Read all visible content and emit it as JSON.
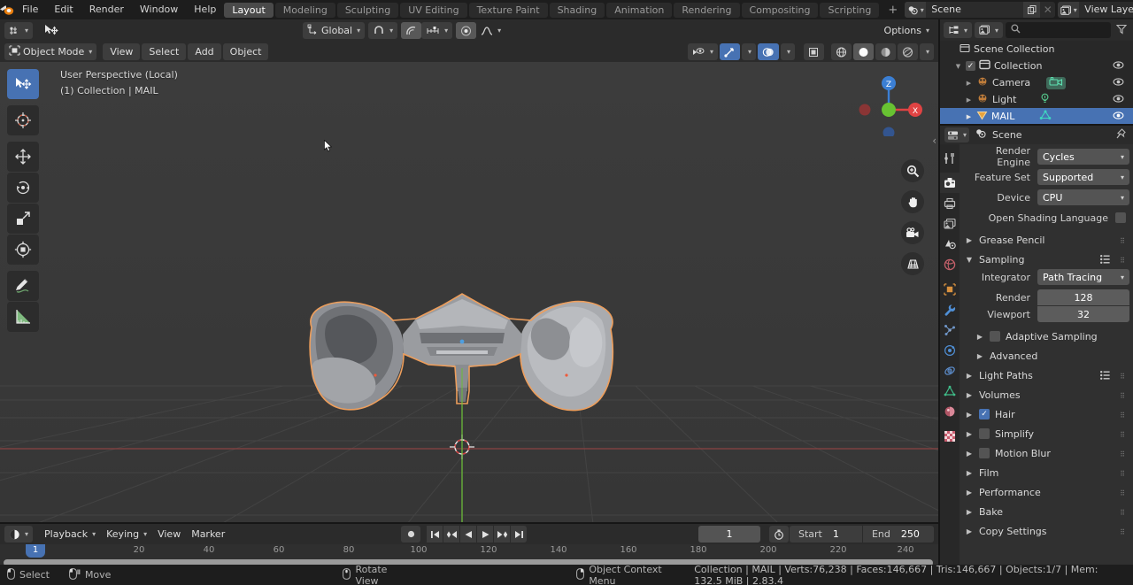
{
  "topbar": {
    "logo_icon": "blender-logo-icon",
    "menus": [
      "File",
      "Edit",
      "Render",
      "Window",
      "Help"
    ],
    "workspaces": [
      {
        "label": "Layout",
        "active": true
      },
      {
        "label": "Modeling",
        "active": false
      },
      {
        "label": "Sculpting",
        "active": false
      },
      {
        "label": "UV Editing",
        "active": false
      },
      {
        "label": "Texture Paint",
        "active": false
      },
      {
        "label": "Shading",
        "active": false
      },
      {
        "label": "Animation",
        "active": false
      },
      {
        "label": "Rendering",
        "active": false
      },
      {
        "label": "Compositing",
        "active": false
      },
      {
        "label": "Scripting",
        "active": false
      }
    ],
    "add_workspace_label": "+",
    "scene_icon": "scene-icon",
    "scene_name": "Scene",
    "viewlayer_icon": "view-layer-icon",
    "viewlayer_name": "View Layer",
    "new_icon": "duplicate-icon",
    "remove_icon": "close-icon"
  },
  "viewport_header": {
    "editor_type_icon": "editor-type-3dview-icon",
    "cursor_tool_icon": "tweak-move-icon",
    "mode_icon": "object-mode-icon",
    "mode_label": "Object Mode",
    "menus": [
      "View",
      "Select",
      "Add",
      "Object"
    ],
    "transform_orientation_icon": "orientation-icon",
    "transform_orientation": "Global",
    "snap_icon": "snap-magnet-icon",
    "proportional_icon": "proportional-edit-icon",
    "proportional_falloff_icon": "falloff-smooth-icon",
    "options_label": "Options",
    "visibility_icon": "show-hide-icon",
    "gizmo_icon": "gizmo-icon",
    "overlays_icon": "overlays-icon",
    "xray_icon": "xray-toggle-icon",
    "shading_modes": [
      "wireframe-shading-icon",
      "solid-shading-icon",
      "material-preview-icon",
      "rendered-shading-icon"
    ],
    "active_shading": "solid-shading-icon"
  },
  "viewport": {
    "overlay_line1": "User Perspective (Local)",
    "overlay_line2": "(1) Collection | MAIL",
    "toolbar_tools": [
      {
        "name": "tweak-tool",
        "icon": "cursor-move-icon",
        "active": true
      },
      {
        "name": "cursor-tool",
        "icon": "3d-cursor-icon",
        "active": false
      },
      {
        "name": "move-tool",
        "icon": "move-arrows-icon",
        "active": false
      },
      {
        "name": "rotate-tool",
        "icon": "rotate-icon",
        "active": false
      },
      {
        "name": "scale-tool",
        "icon": "scale-icon",
        "active": false
      },
      {
        "name": "transform-tool",
        "icon": "transform-icon",
        "active": false
      },
      {
        "name": "annotate-tool",
        "icon": "pencil-icon",
        "active": false
      },
      {
        "name": "measure-tool",
        "icon": "ruler-icon",
        "active": false
      }
    ],
    "gizmo_axes": [
      "Z",
      "X"
    ],
    "nav_buttons": [
      "zoom-icon",
      "pan-hand-icon",
      "camera-view-icon",
      "ortho-persp-icon"
    ],
    "object_name": "MAIL"
  },
  "timeline": {
    "editor_icon": "timeline-editor-icon",
    "menus": [
      "Playback",
      "Keying",
      "View",
      "Marker"
    ],
    "record_icon": "record-keyframe-icon",
    "transport": [
      "jump-start-icon",
      "prev-keyframe-icon",
      "play-reverse-icon",
      "play-icon",
      "next-keyframe-icon",
      "jump-end-icon"
    ],
    "current_frame": "1",
    "timer_icon": "use-preview-range-icon",
    "start_label": "Start",
    "start_value": "1",
    "end_label": "End",
    "end_value": "250",
    "ruler_ticks": [
      "20",
      "40",
      "60",
      "80",
      "100",
      "120",
      "140",
      "160",
      "180",
      "200",
      "220",
      "240"
    ],
    "playhead_label": "1"
  },
  "outliner": {
    "display_mode_icon": "outliner-display-mode-icon",
    "filter_collection_icon": "outliner-filter-id-icon",
    "search_placeholder": "",
    "search_icon": "search-icon",
    "filter_icon": "filter-funnel-icon",
    "rows": [
      {
        "label": "Scene Collection",
        "icon": "scene-collection-icon",
        "indent": 0,
        "selected": false,
        "has_eye": false,
        "has_checkbox": false,
        "has_disclosure": false
      },
      {
        "label": "Collection",
        "icon": "collection-icon",
        "indent": 1,
        "selected": false,
        "has_eye": true,
        "has_checkbox": true,
        "has_disclosure": true
      },
      {
        "label": "Camera",
        "icon": "camera-object-icon",
        "data_icon": "camera-data-icon",
        "indent": 2,
        "selected": false,
        "has_eye": true,
        "has_checkbox": false,
        "has_disclosure": true
      },
      {
        "label": "Light",
        "icon": "light-object-icon",
        "data_icon": "light-data-icon",
        "indent": 2,
        "selected": false,
        "has_eye": true,
        "has_checkbox": false,
        "has_disclosure": true
      },
      {
        "label": "MAIL",
        "icon": "mesh-object-icon",
        "data_icon": "mesh-data-icon",
        "indent": 2,
        "selected": true,
        "has_eye": true,
        "has_checkbox": false,
        "has_disclosure": true
      }
    ]
  },
  "properties": {
    "editor_icon": "properties-editor-icon",
    "breadcrumb_icon": "scene-icon",
    "breadcrumb": "Scene",
    "pin_icon": "pin-icon",
    "tabs": [
      {
        "name": "tool-tab",
        "icon": "tool-icon",
        "active": false
      },
      {
        "name": "render-tab",
        "icon": "render-camera-icon",
        "active": true
      },
      {
        "name": "output-tab",
        "icon": "printer-icon",
        "active": false
      },
      {
        "name": "viewlayer-tab",
        "icon": "images-icon",
        "active": false
      },
      {
        "name": "scene-tab",
        "icon": "scene-cone-icon",
        "active": false
      },
      {
        "name": "world-tab",
        "icon": "world-globe-icon",
        "active": false
      },
      {
        "name": "object-tab",
        "icon": "object-square-icon",
        "active": false
      },
      {
        "name": "modifier-tab",
        "icon": "wrench-icon",
        "active": false
      },
      {
        "name": "particles-tab",
        "icon": "particles-icon",
        "active": false
      },
      {
        "name": "physics-tab",
        "icon": "physics-orbit-icon",
        "active": false
      },
      {
        "name": "constraints-tab",
        "icon": "constraints-icon",
        "active": false
      },
      {
        "name": "data-tab",
        "icon": "mesh-data-triangle-icon",
        "active": false
      },
      {
        "name": "material-tab",
        "icon": "material-sphere-icon",
        "active": false
      },
      {
        "name": "texture-tab",
        "icon": "texture-checker-icon",
        "active": false
      }
    ],
    "fields": [
      {
        "label": "Render Engine",
        "value": "Cycles",
        "type": "dropdown"
      },
      {
        "label": "Feature Set",
        "value": "Supported",
        "type": "dropdown"
      },
      {
        "label": "Device",
        "value": "CPU",
        "type": "dropdown"
      }
    ],
    "osl_label": "Open Shading Language",
    "osl_checked": false,
    "panels": [
      {
        "label": "Grease Pencil",
        "open": false,
        "indent": 0,
        "checkbox": null,
        "list_icon": false
      },
      {
        "label": "Sampling",
        "open": true,
        "indent": 0,
        "checkbox": null,
        "list_icon": true
      }
    ],
    "sampling": {
      "integrator_label": "Integrator",
      "integrator_value": "Path Tracing",
      "render_label": "Render",
      "render_value": "128",
      "viewport_label": "Viewport",
      "viewport_value": "32",
      "adaptive_label": "Adaptive Sampling",
      "adaptive_checked": false,
      "advanced_label": "Advanced"
    },
    "panels2": [
      {
        "label": "Light Paths",
        "open": false,
        "checkbox": null,
        "list_icon": true
      },
      {
        "label": "Volumes",
        "open": false,
        "checkbox": null,
        "list_icon": false
      },
      {
        "label": "Hair",
        "open": false,
        "checkbox": true,
        "list_icon": false
      },
      {
        "label": "Simplify",
        "open": false,
        "checkbox": false,
        "list_icon": false
      },
      {
        "label": "Motion Blur",
        "open": false,
        "checkbox": false,
        "list_icon": false
      },
      {
        "label": "Film",
        "open": false,
        "checkbox": null,
        "list_icon": false
      },
      {
        "label": "Performance",
        "open": false,
        "checkbox": null,
        "list_icon": false
      },
      {
        "label": "Bake",
        "open": false,
        "checkbox": null,
        "list_icon": false
      },
      {
        "label": "Copy Settings",
        "open": false,
        "checkbox": null,
        "list_icon": false
      }
    ]
  },
  "statusbar": {
    "hints": [
      {
        "icon": "mouse-left-icon",
        "label": "Select"
      },
      {
        "icon": "mouse-move-icon",
        "label": "Move"
      },
      {
        "icon": "mouse-middle-icon",
        "label": "Rotate View"
      },
      {
        "icon": "mouse-right-icon",
        "label": "Object Context Menu"
      }
    ],
    "stats": "Collection | MAIL | Verts:76,238 | Faces:146,667 | Tris:146,667 | Objects:1/7 | Mem: 132.5 MiB | 2.83.4"
  },
  "colors": {
    "accent_blue": "#4772b3",
    "outline_orange": "#ed9e5c",
    "axis_x": "#e04343",
    "axis_y": "#68c232",
    "axis_z": "#3b7fd4",
    "viewport_bg": "#393939",
    "panel_bg": "#303030",
    "header_bg": "#2b2b2b",
    "topbar_bg": "#1d1d1d"
  }
}
